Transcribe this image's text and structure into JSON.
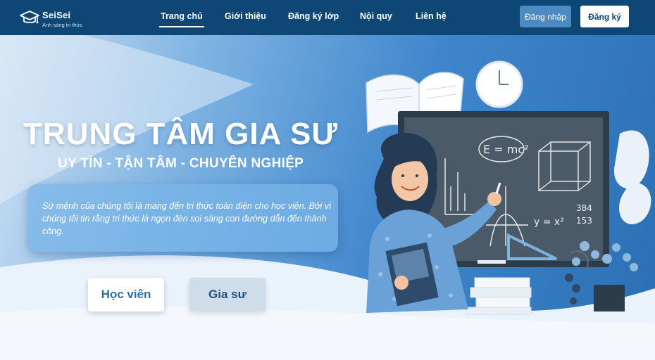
{
  "header": {
    "brand": "SeiSei",
    "slogan": "Ánh sáng tri thức",
    "nav": [
      {
        "label": "Trang chủ",
        "active": true
      },
      {
        "label": "Giới thiệu",
        "active": false
      },
      {
        "label": "Đăng ký lớp",
        "active": false
      },
      {
        "label": "Nội quy",
        "active": false
      },
      {
        "label": "Liên hệ",
        "active": false
      }
    ],
    "login_label": "Đăng nhập",
    "register_label": "Đăng ký"
  },
  "hero": {
    "title": "TRUNG TÂM GIA SƯ",
    "subtitle": "UY TÍN - TẬN TÂM - CHUYÊN NGHIỆP",
    "mission": "Sứ mệnh của chúng tôi là mang đến tri thức toàn diện cho học viên. Bởi vì chúng tôi tin rằng tri thức là ngọn đèn soi sáng con đường dẫn đến thành công.",
    "student_button": "Học viên",
    "tutor_button": "Gia sư"
  },
  "colors": {
    "navbar": "#0e4675",
    "login_button": "#4c8ac2",
    "hero_dark": "#2a6fb3",
    "hero_light": "#cfe1f3"
  },
  "icons": [
    "graduation-cap-icon"
  ]
}
